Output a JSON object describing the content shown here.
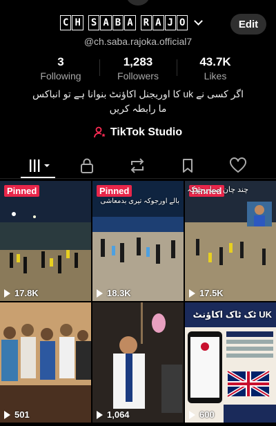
{
  "profile": {
    "username_chars": [
      "C",
      "H",
      "S",
      "A",
      "B",
      "A",
      "R",
      "A",
      "J",
      "O"
    ],
    "username_groups": [
      2,
      4,
      4
    ],
    "handle": "@ch.saba.rajoka.official7",
    "edit_label": "Edit",
    "bio": "اگر کسی نے uk کا اوریجنل اکاؤنٹ بنوانا ہے تو انباکس ما رابطہ کریں",
    "studio_label": "TikTok Studio"
  },
  "stats": [
    {
      "value": "3",
      "label": "Following"
    },
    {
      "value": "1,283",
      "label": "Followers"
    },
    {
      "value": "43.7K",
      "label": "Likes"
    }
  ],
  "tabs": [
    {
      "icon": "videos-grid-icon"
    },
    {
      "icon": "lock-icon"
    },
    {
      "icon": "repost-icon"
    },
    {
      "icon": "bookmark-icon"
    },
    {
      "icon": "heart-icon"
    }
  ],
  "videos": [
    {
      "pinned_label": "Pinned",
      "views": "17.8K",
      "caption": ""
    },
    {
      "pinned_label": "Pinned",
      "views": "18.3K",
      "caption": "بالے اورجوکہ تیری بدمعاشی"
    },
    {
      "pinned_label": "Pinned",
      "views": "17.5K",
      "caption": "چند چان صبا رجوکہ"
    },
    {
      "pinned_label": "",
      "views": "501",
      "caption": ""
    },
    {
      "pinned_label": "",
      "views": "1,064",
      "caption": ""
    },
    {
      "pinned_label": "",
      "views": "600",
      "caption": "UK ٹک ٹاک اکاؤنٹ"
    }
  ],
  "colors": {
    "background": "#000000",
    "pinned_badge": "#e8264a",
    "studio_icon": "#fe2c55",
    "edit_button": "#2f2f2f"
  }
}
